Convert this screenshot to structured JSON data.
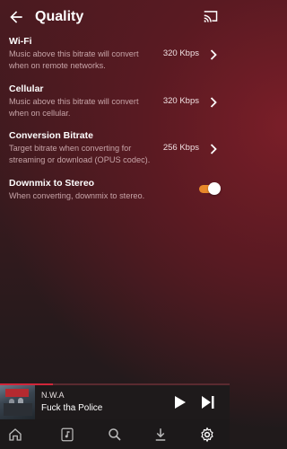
{
  "header": {
    "title": "Quality",
    "back_icon": "arrow-back-icon",
    "cast_icon": "cast-icon"
  },
  "settings": [
    {
      "title": "Wi-Fi",
      "description": "Music above this bitrate will convert when on remote networks.",
      "value": "320 Kbps"
    },
    {
      "title": "Cellular",
      "description": "Music above this bitrate will convert when on cellular.",
      "value": "320 Kbps"
    },
    {
      "title": "Conversion Bitrate",
      "description": "Target bitrate when converting for streaming or download (OPUS codec).",
      "value": "256 Kbps"
    },
    {
      "title": "Downmix to Stereo",
      "description": "When converting, downmix to stereo.",
      "toggle_on": true
    }
  ],
  "player": {
    "artist": "N.W.A",
    "title": "Fuck tha Police",
    "progress_fraction": 0.23
  },
  "bottom_nav": {
    "items": [
      "home-icon",
      "music-note-icon",
      "search-icon",
      "download-icon",
      "settings-icon"
    ],
    "active": "settings-icon"
  },
  "colors": {
    "accent": "#e8882a",
    "progress": "#d0263a"
  }
}
